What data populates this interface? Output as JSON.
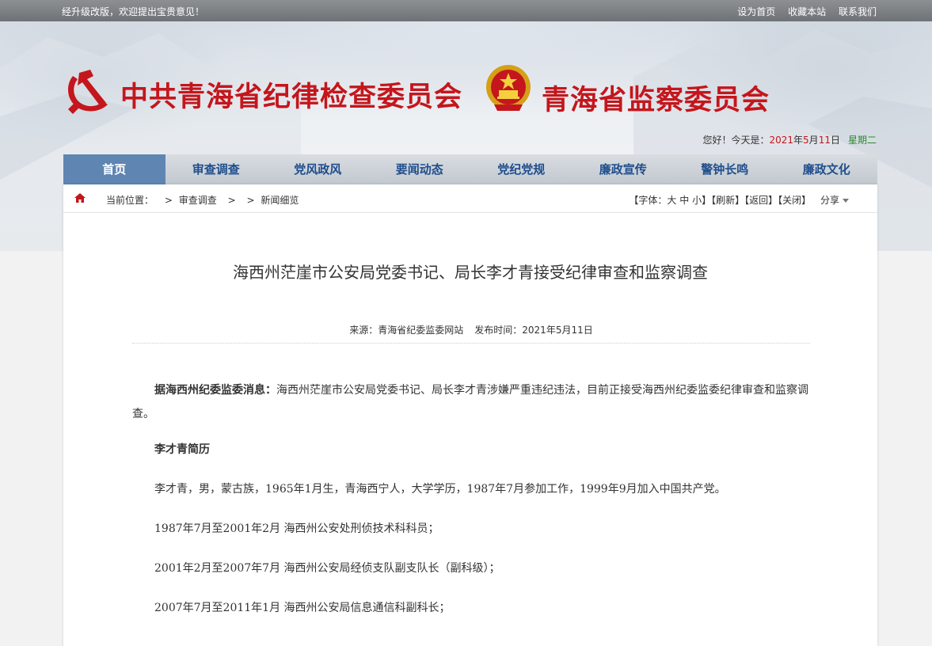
{
  "topbar": {
    "notice": "经升级改版，欢迎提出宝贵意见！",
    "links": [
      "设为首页",
      "收藏本站",
      "联系我们"
    ]
  },
  "header": {
    "title_left": "中共青海省纪律检查委员会",
    "title_right": "青海省监察委员会",
    "date_prefix": "您好！今天是：",
    "year": "2021",
    "year_unit": "年",
    "month": "5",
    "month_unit": "月",
    "day": "11",
    "day_unit": "日",
    "weekday": "星期二"
  },
  "nav": {
    "items": [
      "首页",
      "审查调查",
      "党风政风",
      "要闻动态",
      "党纪党规",
      "廉政宣传",
      "警钟长鸣",
      "廉政文化"
    ],
    "active_index": 0
  },
  "breadcrumb": {
    "label": "当前位置：",
    "sep": ">",
    "level1": "审查调查",
    "level2": "新闻细览",
    "font_label": "【字体：",
    "font_large": "大",
    "font_medium": "中",
    "font_small": "小",
    "font_close": "】",
    "refresh": "【刷新】",
    "back": "【返回】",
    "close": "【关闭】",
    "share": "分享"
  },
  "article": {
    "title": "海西州茫崖市公安局党委书记、局长李才青接受纪律审查和监察调查",
    "source": "来源：青海省纪委监委网站",
    "published": "发布时间：2021年5月11日",
    "lead_bold": "据海西州纪委监委消息：",
    "lead_text": "海西州茫崖市公安局党委书记、局长李才青涉嫌严重违纪违法，目前正接受海西州纪委监委纪律审查和监察调查。",
    "resume_heading": "李才青简历",
    "bio": "李才青，男，蒙古族，1965年1月生，青海西宁人，大学学历，1987年7月参加工作，1999年9月加入中国共产党。",
    "career": [
      "1987年7月至2001年2月 海西州公安处刑侦技术科科员；",
      "2001年2月至2007年7月 海西州公安局经侦支队副支队长（副科级）；",
      "2007年7月至2011年1月 海西州公安局信息通信科副科长；"
    ]
  },
  "colors": {
    "party_red": "#c4161c",
    "nav_blue": "#1f4e8c",
    "nav_active": "#5f85b3"
  }
}
